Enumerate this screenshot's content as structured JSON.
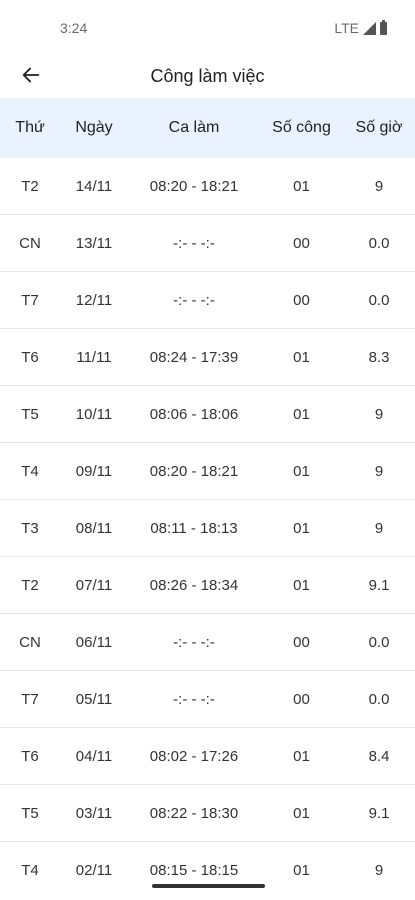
{
  "status_bar": {
    "time": "3:24",
    "network": "LTE"
  },
  "app_bar": {
    "title": "Công làm việc"
  },
  "table": {
    "columns": [
      "Thứ",
      "Ngày",
      "Ca làm",
      "Số công",
      "Số giờ"
    ],
    "rows": [
      [
        "T2",
        "14/11",
        "08:20 - 18:21",
        "01",
        "9"
      ],
      [
        "CN",
        "13/11",
        "-:- - -:-",
        "00",
        "0.0"
      ],
      [
        "T7",
        "12/11",
        "-:- - -:-",
        "00",
        "0.0"
      ],
      [
        "T6",
        "11/11",
        "08:24 - 17:39",
        "01",
        "8.3"
      ],
      [
        "T5",
        "10/11",
        "08:06 - 18:06",
        "01",
        "9"
      ],
      [
        "T4",
        "09/11",
        "08:20 - 18:21",
        "01",
        "9"
      ],
      [
        "T3",
        "08/11",
        "08:11 - 18:13",
        "01",
        "9"
      ],
      [
        "T2",
        "07/11",
        "08:26 - 18:34",
        "01",
        "9.1"
      ],
      [
        "CN",
        "06/11",
        "-:- - -:-",
        "00",
        "0.0"
      ],
      [
        "T7",
        "05/11",
        "-:- - -:-",
        "00",
        "0.0"
      ],
      [
        "T6",
        "04/11",
        "08:02 - 17:26",
        "01",
        "8.4"
      ],
      [
        "T5",
        "03/11",
        "08:22 - 18:30",
        "01",
        "9.1"
      ],
      [
        "T4",
        "02/11",
        "08:15 - 18:15",
        "01",
        "9"
      ]
    ]
  }
}
